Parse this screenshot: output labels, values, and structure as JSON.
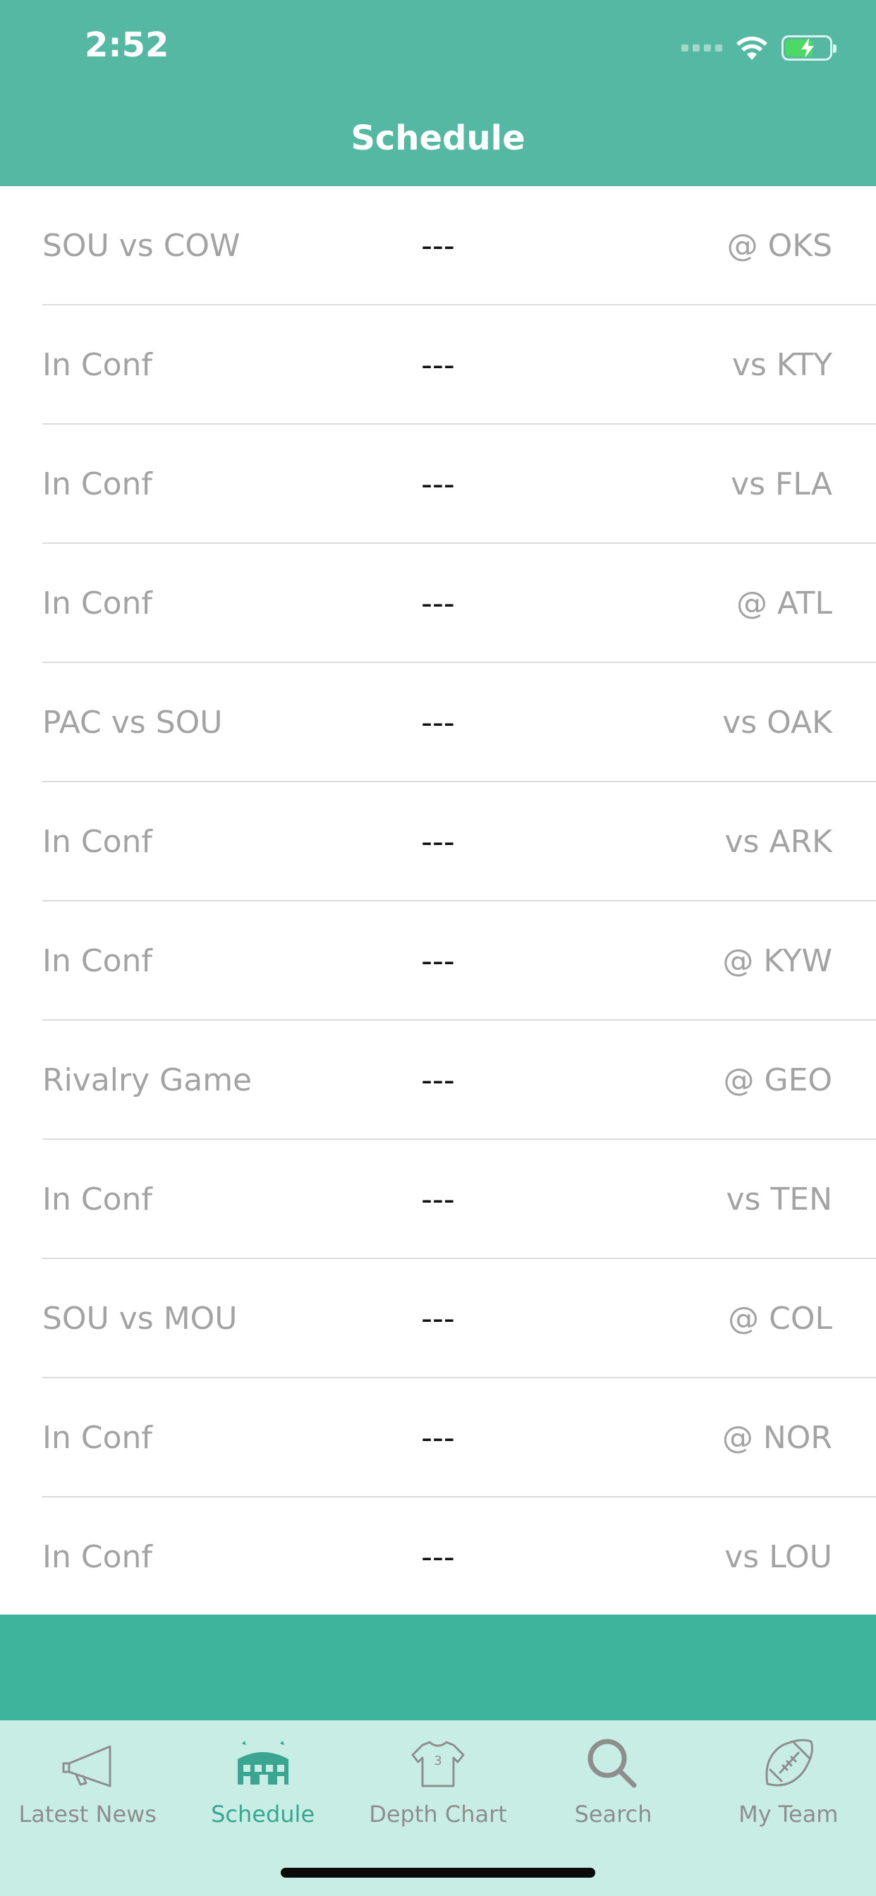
{
  "status_bar": {
    "time": "2:52"
  },
  "nav": {
    "title": "Schedule"
  },
  "schedule": [
    {
      "label": "SOU vs COW",
      "result": "---",
      "opponent": "@ OKS"
    },
    {
      "label": "In Conf",
      "result": "---",
      "opponent": "vs KTY"
    },
    {
      "label": "In Conf",
      "result": "---",
      "opponent": "vs FLA"
    },
    {
      "label": "In Conf",
      "result": "---",
      "opponent": "@ ATL"
    },
    {
      "label": "PAC vs SOU",
      "result": "---",
      "opponent": "vs OAK"
    },
    {
      "label": "In Conf",
      "result": "---",
      "opponent": "vs ARK"
    },
    {
      "label": "In Conf",
      "result": "---",
      "opponent": "@ KYW"
    },
    {
      "label": "Rivalry Game",
      "result": "---",
      "opponent": "@ GEO"
    },
    {
      "label": "In Conf",
      "result": "---",
      "opponent": "vs TEN"
    },
    {
      "label": "SOU vs MOU",
      "result": "---",
      "opponent": "@ COL"
    },
    {
      "label": "In Conf",
      "result": "---",
      "opponent": "@ NOR"
    },
    {
      "label": "In Conf",
      "result": "---",
      "opponent": "vs LOU"
    }
  ],
  "tabbar": {
    "tabs": [
      {
        "label": "Latest News",
        "icon": "megaphone-icon",
        "active": false
      },
      {
        "label": "Schedule",
        "icon": "stadium-icon",
        "active": true
      },
      {
        "label": "Depth Chart",
        "icon": "jersey-icon",
        "active": false
      },
      {
        "label": "Search",
        "icon": "search-icon",
        "active": false
      },
      {
        "label": "My Team",
        "icon": "football-icon",
        "active": false
      }
    ]
  },
  "colors": {
    "header": "#54b8a3",
    "banner": "#3db39c",
    "tabbar": "#c7ede5",
    "active_tab": "#3aa692",
    "inactive_tab": "#8e8e8e"
  }
}
